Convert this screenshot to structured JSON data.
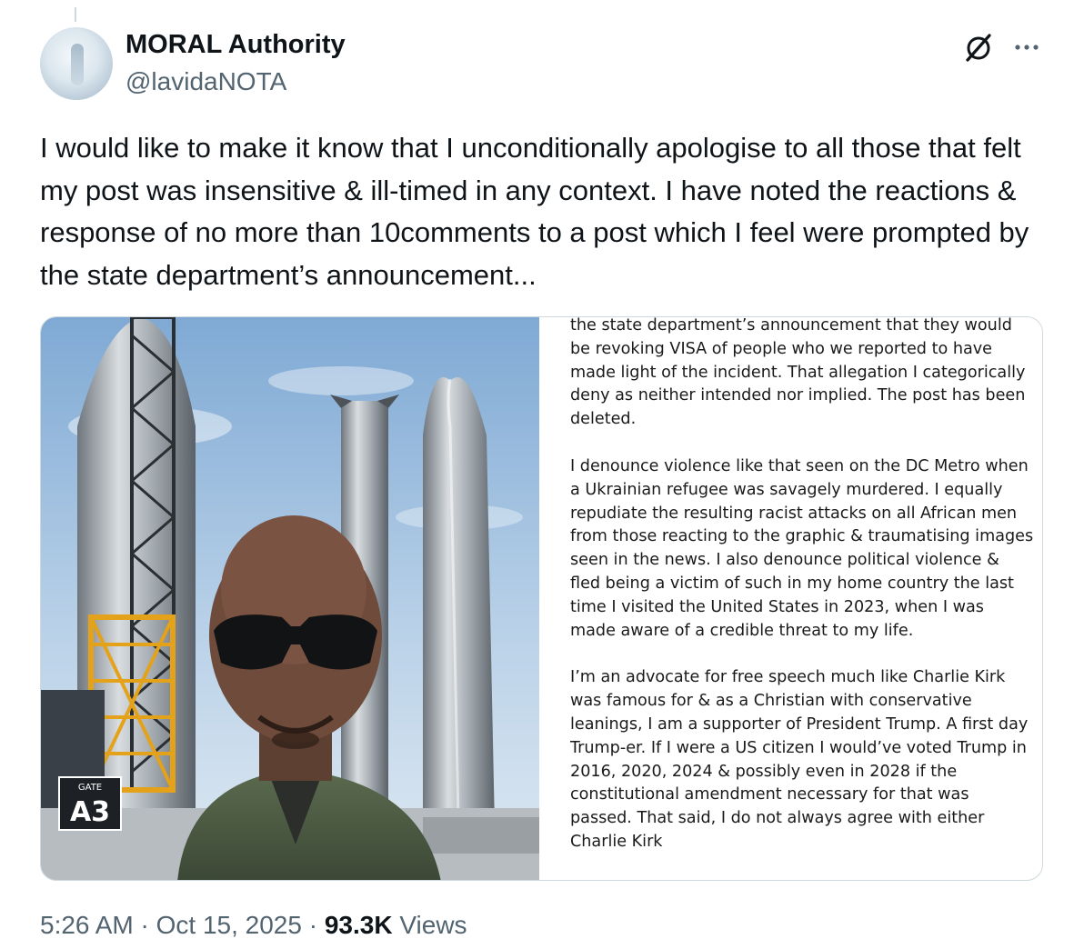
{
  "author": {
    "display_name": "MORAL Authority",
    "handle": "@lavidaNOTA"
  },
  "icons": {
    "grok": "grok-icon",
    "more": "more-options-icon"
  },
  "tweet": {
    "text": "I would like to make it know that I unconditionally apologise to all those that felt my post was insensitive & ill-timed in any context. I have noted the reactions & response of no more than 10comments to a post which I feel were prompted by the state department’s announcement..."
  },
  "media": {
    "photo": {
      "gate_label": "GATE",
      "gate_number": "A3"
    },
    "screenshot_paragraphs": [
      "the state department’s announcement that they would be revoking VISA of people who we reported to have made light of the incident. That allegation I categorically deny as neither intended nor implied. The post has been deleted.",
      "I denounce violence like that seen on the DC Metro when a Ukrainian refugee was savagely murdered. I equally repudiate the resulting racist attacks on all African men from those reacting to the graphic & traumatising images seen in the news. I also denounce political violence & fled being a victim of such in my home country the last time I visited the United States in 2023, when I was made aware of a credible threat to my life.",
      "I’m an advocate for free speech much like Charlie Kirk was famous for & as a Christian with conservative leanings, I am a supporter of President Trump. A first day Trump-er. If I were a US citizen I would’ve voted Trump in 2016, 2020, 2024 & possibly even in 2028 if the constitutional amendment necessary for that was passed. That said, I do not always agree with either Charlie Kirk"
    ]
  },
  "meta": {
    "time": "5:26 AM",
    "separator": "·",
    "date": "Oct 15, 2025",
    "views_count": "93.3K",
    "views_label": "Views"
  }
}
